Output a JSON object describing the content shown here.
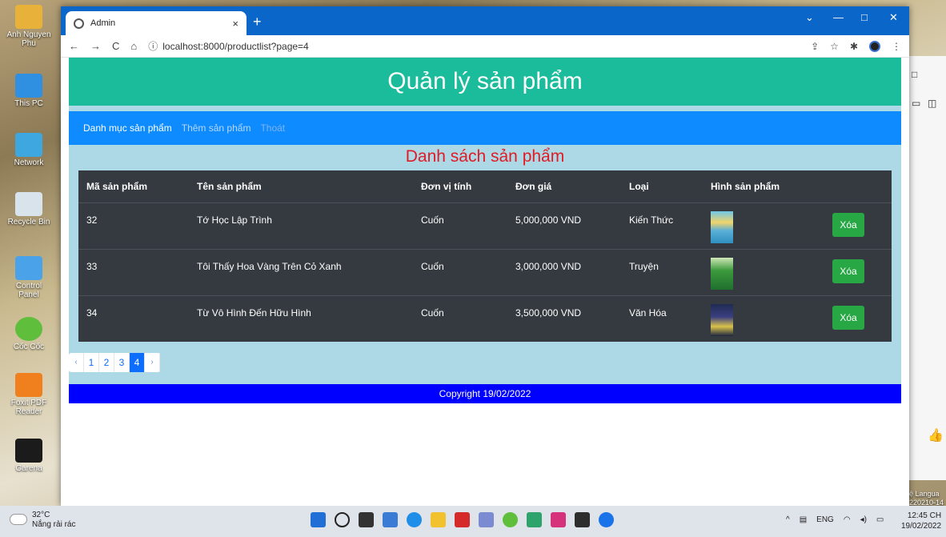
{
  "desktop": {
    "icons": [
      "Anh Nguyen Phu",
      "This PC",
      "Network",
      "Recycle Bin",
      "Control Panel",
      "Cốc Cốc",
      "Foxit PDF Reader",
      "Garena"
    ]
  },
  "browser": {
    "tab_title": "Admin",
    "tab_close": "×",
    "new_tab": "+",
    "url": "localhost:8000/productlist?page=4",
    "nav": {
      "back": "←",
      "forward": "→",
      "reload": "C",
      "home": "⌂",
      "info": "ⓘ"
    },
    "window_controls": {
      "minimize": "—",
      "maximize": "□",
      "close": "✕",
      "dropdown": "⌄"
    },
    "toolbar_icons": {
      "share": "⇪",
      "star": "☆",
      "extensions": "✱",
      "menu": "⋮"
    }
  },
  "page": {
    "header": "Quản lý sản phẩm",
    "nav": [
      "Danh mục sản phẩm",
      "Thêm sản phẩm",
      "Thoát"
    ],
    "list_title": "Danh sách sản phẩm",
    "columns": [
      "Mã sản phẩm",
      "Tên sản phẩm",
      "Đơn vị tính",
      "Đơn giá",
      "Loại",
      "Hình sản phẩm"
    ],
    "rows": [
      {
        "id": "32",
        "name": "Tớ Học Lập Trình",
        "unit": "Cuốn",
        "price": "5,000,000 VND",
        "type": "Kiến Thức",
        "delete": "Xóa"
      },
      {
        "id": "33",
        "name": "Tôi Thấy Hoa Vàng Trên Cỏ Xanh",
        "unit": "Cuốn",
        "price": "3,000,000 VND",
        "type": "Truyện",
        "delete": "Xóa"
      },
      {
        "id": "34",
        "name": "Từ Vô Hình Đến Hữu Hình",
        "unit": "Cuốn",
        "price": "3,500,000 VND",
        "type": "Văn Hóa",
        "delete": "Xóa"
      }
    ],
    "pagination": {
      "prev": "‹",
      "pages": [
        "1",
        "2",
        "3",
        "4"
      ],
      "next": "›",
      "current": "4"
    },
    "footer": "Copyright 19/02/2022"
  },
  "taskbar": {
    "temperature": "32°C",
    "weather": "Nắng rải rác",
    "lang": "ENG",
    "time": "12:45 CH",
    "date": "19/02/2022"
  },
  "right_window": {
    "lang_text": "ệ Langua",
    "build": "220210-14"
  }
}
